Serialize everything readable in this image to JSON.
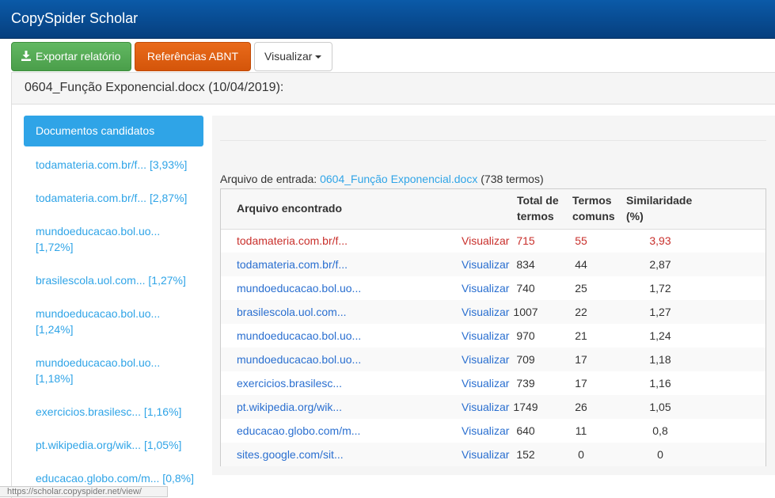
{
  "app": {
    "title": "CopySpider Scholar"
  },
  "toolbar": {
    "export_label": "Exportar relatório",
    "abnt_label": "Referências ABNT",
    "view_label": "Visualizar"
  },
  "report": {
    "heading": "0604_Função Exponencial.docx (10/04/2019):"
  },
  "sidebar": {
    "active_label": "Documentos candidatos",
    "items": [
      "todamateria.com.br/f... [3,93%]",
      "todamateria.com.br/f... [2,87%]",
      "mundoeducacao.bol.uo... [1,72%]",
      "brasilescola.uol.com... [1,27%]",
      "mundoeducacao.bol.uo... [1,24%]",
      "mundoeducacao.bol.uo... [1,18%]",
      "exercicios.brasilesc... [1,16%]",
      "pt.wikipedia.org/wik... [1,05%]",
      "educacao.globo.com/m... [0,8%]"
    ]
  },
  "input": {
    "prefix": "Arquivo de entrada:",
    "file": "0604_Função Exponencial.docx",
    "terms": "(738 termos)"
  },
  "table": {
    "headers": {
      "file": "Arquivo encontrado",
      "total": "Total de termos",
      "common": "Termos comuns",
      "similarity": "Similaridade (%)"
    },
    "rows": [
      {
        "file": "todamateria.com.br/f...",
        "action": "Visualizar",
        "total": "715",
        "common": "55",
        "similarity": "3,93"
      },
      {
        "file": "todamateria.com.br/f...",
        "action": "Visualizar",
        "total": "834",
        "common": "44",
        "similarity": "2,87"
      },
      {
        "file": "mundoeducacao.bol.uo...",
        "action": "Visualizar",
        "total": "740",
        "common": "25",
        "similarity": "1,72"
      },
      {
        "file": "brasilescola.uol.com...",
        "action": "Visualizar",
        "total": "1007",
        "common": "22",
        "similarity": "1,27"
      },
      {
        "file": "mundoeducacao.bol.uo...",
        "action": "Visualizar",
        "total": "970",
        "common": "21",
        "similarity": "1,24"
      },
      {
        "file": "mundoeducacao.bol.uo...",
        "action": "Visualizar",
        "total": "709",
        "common": "17",
        "similarity": "1,18"
      },
      {
        "file": "exercicios.brasilesc...",
        "action": "Visualizar",
        "total": "739",
        "common": "17",
        "similarity": "1,16"
      },
      {
        "file": "pt.wikipedia.org/wik...",
        "action": "Visualizar",
        "total": "1749",
        "common": "26",
        "similarity": "1,05"
      },
      {
        "file": "educacao.globo.com/m...",
        "action": "Visualizar",
        "total": "640",
        "common": "11",
        "similarity": "0,8"
      },
      {
        "file": "sites.google.com/sit...",
        "action": "Visualizar",
        "total": "152",
        "common": "0",
        "similarity": "0"
      }
    ]
  },
  "status": {
    "url": "https://scholar.copyspider.net/view/"
  },
  "colors": {
    "navbar": "#063f7e",
    "link": "#2fa4e7",
    "highlight": "#c9302c",
    "export_button": "#5cb85c",
    "abnt_button": "#e96a1a"
  }
}
